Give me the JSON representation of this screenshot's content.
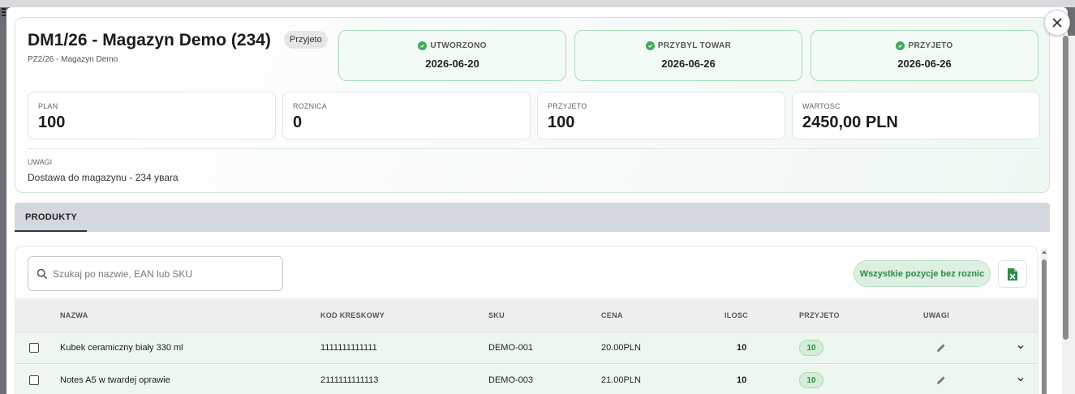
{
  "header": {
    "title": "DM1/26 - Magazyn Demo (234)",
    "status": "Przyjeto",
    "subtitle": "PZ2/26 - Magazyn Demo",
    "steps": [
      {
        "label": "UTWORZONO",
        "date": "2026-06-20"
      },
      {
        "label": "PRZYBYL TOWAR",
        "date": "2026-06-26"
      },
      {
        "label": "PRZYJETO",
        "date": "2026-06-26"
      }
    ],
    "stats": [
      {
        "label": "PLAN",
        "value": "100"
      },
      {
        "label": "ROZNICA",
        "value": "0"
      },
      {
        "label": "PRZYJETO",
        "value": "100"
      },
      {
        "label": "WARTOSC",
        "value": "2450,00 PLN"
      }
    ],
    "notes_label": "UWAGI",
    "notes_text": "Dostawa do magazynu - 234 уваra"
  },
  "tabs": [
    {
      "label": "PRODUKTY"
    }
  ],
  "products": {
    "search_placeholder": "Szukaj po nazwie, EAN lub SKU",
    "no_diff_button": "Wszystkie pozycje bez roznic",
    "columns": [
      "NAZWA",
      "KOD KRESKOWY",
      "SKU",
      "CENA",
      "ILOSC",
      "PRZYJETO",
      "UWAGI"
    ],
    "rows": [
      {
        "name": "Kubek ceramiczny biały 330 ml",
        "barcode": "1111111111111",
        "sku": "DEMO-001",
        "price": "20.00PLN",
        "qty": "10",
        "received": "10"
      },
      {
        "name": "Notes A5 w twardej oprawie",
        "barcode": "2111111111113",
        "sku": "DEMO-003",
        "price": "21.00PLN",
        "qty": "10",
        "received": "10"
      }
    ]
  },
  "colors": {
    "accent_green": "#3eaa5c",
    "tab_bar": "#d2d8dd"
  },
  "icons": [
    "close-icon",
    "check-circle-icon",
    "search-icon",
    "excel-icon",
    "pencil-icon",
    "chevron-down-icon"
  ]
}
